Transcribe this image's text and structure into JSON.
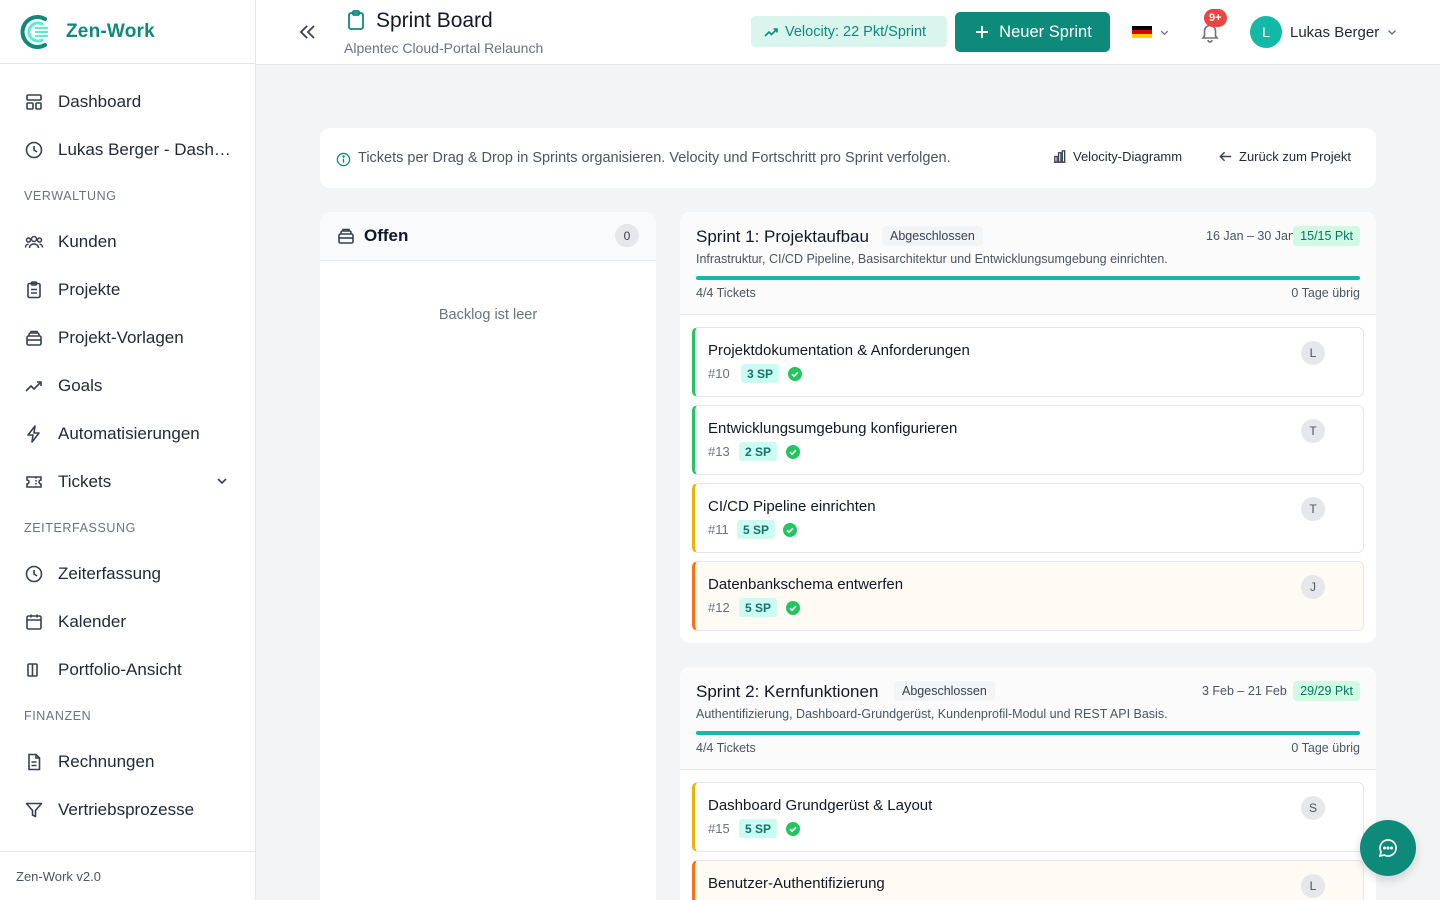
{
  "app": {
    "name": "Zen-Work",
    "version": "Zen-Work v2.0"
  },
  "sidebar": {
    "items": [
      {
        "label": "Dashboard",
        "icon": "dashboard-icon"
      },
      {
        "label": "Lukas Berger - Dashboard",
        "icon": "clock-icon"
      }
    ],
    "sections": [
      {
        "title": "VERWALTUNG",
        "items": [
          {
            "label": "Kunden",
            "icon": "users-icon"
          },
          {
            "label": "Projekte",
            "icon": "clipboard-icon"
          },
          {
            "label": "Projekt-Vorlagen",
            "icon": "template-icon"
          },
          {
            "label": "Goals",
            "icon": "trend-icon"
          },
          {
            "label": "Automatisierungen",
            "icon": "bolt-icon"
          },
          {
            "label": "Tickets",
            "icon": "ticket-icon"
          }
        ]
      },
      {
        "title": "ZEITERFASSUNG",
        "items": [
          {
            "label": "Zeiterfassung",
            "icon": "clock-icon"
          },
          {
            "label": "Kalender",
            "icon": "calendar-icon"
          },
          {
            "label": "Portfolio-Ansicht",
            "icon": "columns-icon"
          }
        ]
      },
      {
        "title": "FINANZEN",
        "items": [
          {
            "label": "Rechnungen",
            "icon": "document-icon"
          },
          {
            "label": "Vertriebsprozesse",
            "icon": "filter-icon"
          }
        ]
      }
    ]
  },
  "header": {
    "title": "Sprint Board",
    "subtitle": "Alpentec Cloud-Portal Relaunch",
    "velocity": "Velocity: 22 Pkt/Sprint",
    "new_sprint": "Neuer Sprint",
    "notifications": "9+",
    "user_initial": "L",
    "user_name": "Lukas Berger",
    "language": "de"
  },
  "infobar": {
    "text": "Tickets per Drag & Drop in Sprints organisieren. Velocity und Fortschritt pro Sprint verfolgen.",
    "velocity_link": "Velocity-Diagramm",
    "back_link": "Zurück zum Projekt"
  },
  "backlog": {
    "title": "Offen",
    "count": "0",
    "empty_text": "Backlog ist leer"
  },
  "sprints": [
    {
      "name": "Sprint 1: Projektaufbau",
      "status": "Abgeschlossen",
      "dates": "16 Jan – 30 Jan",
      "points": "15/15 Pkt",
      "description": "Infrastruktur, CI/CD Pipeline, Basisarchitektur und Entwicklungsumgebung einrichten.",
      "progress": 1.0,
      "tickets_label": "4/4 Tickets",
      "days_left": "0 Tage übrig",
      "tickets": [
        {
          "title": "Projektdokumentation & Anforderungen",
          "id": "#10",
          "sp": "3 SP",
          "assignee": "L",
          "accent": "#22c55e",
          "bg": "#ffffff"
        },
        {
          "title": "Entwicklungsumgebung konfigurieren",
          "id": "#13",
          "sp": "2 SP",
          "assignee": "T",
          "accent": "#22c55e",
          "bg": "#ffffff"
        },
        {
          "title": "CI/CD Pipeline einrichten",
          "id": "#11",
          "sp": "5 SP",
          "assignee": "T",
          "accent": "#eab308",
          "bg": "#ffffff"
        },
        {
          "title": "Datenbankschema entwerfen",
          "id": "#12",
          "sp": "5 SP",
          "assignee": "J",
          "accent": "#f97316",
          "bg": "#fffaf3"
        }
      ]
    },
    {
      "name": "Sprint 2: Kernfunktionen",
      "status": "Abgeschlossen",
      "dates": "3 Feb – 21 Feb",
      "points": "29/29 Pkt",
      "description": "Authentifizierung, Dashboard-Grundgerüst, Kundenprofil-Modul und REST API Basis.",
      "progress": 1.0,
      "tickets_label": "4/4 Tickets",
      "days_left": "0 Tage übrig",
      "tickets": [
        {
          "title": "Dashboard Grundgerüst & Layout",
          "id": "#15",
          "sp": "5 SP",
          "assignee": "S",
          "accent": "#eab308",
          "bg": "#ffffff"
        },
        {
          "title": "Benutzer-Authentifizierung",
          "id": "",
          "sp": "",
          "assignee": "L",
          "accent": "#f97316",
          "bg": "#fffaf3"
        }
      ]
    }
  ],
  "colors": {
    "brand": "#0e8a7a",
    "success": "#22c55e",
    "accent_teal": "#14b8a6"
  }
}
